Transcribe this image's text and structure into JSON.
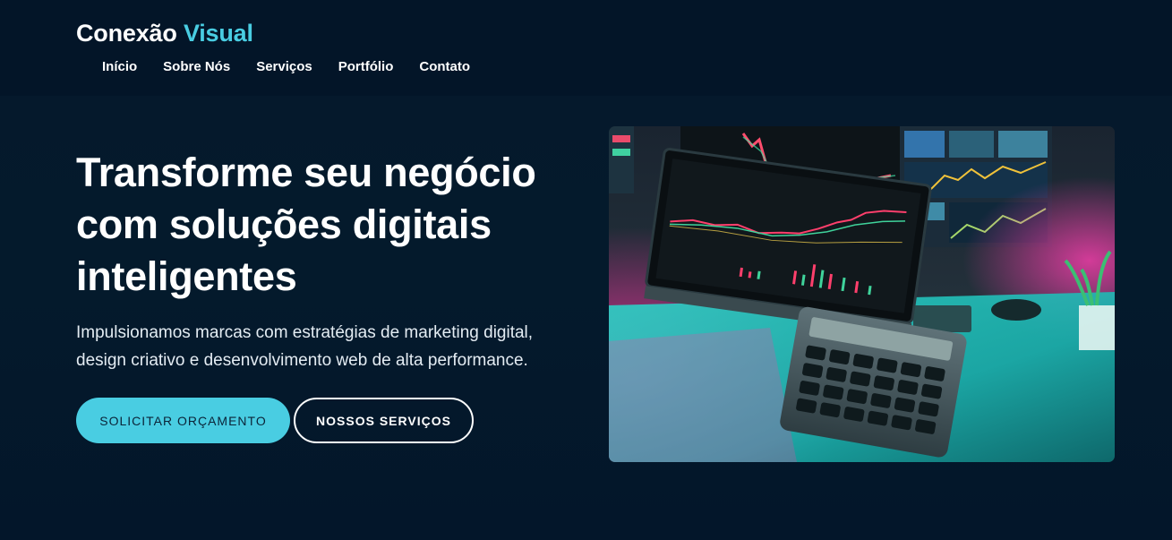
{
  "header": {
    "logo_main": "Conexão",
    "logo_accent": "Visual",
    "nav": [
      {
        "label": "Início"
      },
      {
        "label": "Sobre Nós"
      },
      {
        "label": "Serviços"
      },
      {
        "label": "Portfólio"
      },
      {
        "label": "Contato"
      }
    ]
  },
  "hero": {
    "title": "Transforme seu negócio com soluções digitais inteligentes",
    "subtitle": "Impulsionamos marcas com estratégias de marketing digital, design criativo e desenvolvimento web de alta performance.",
    "primary_button": "SOLICITAR ORÇAMENTO",
    "secondary_button": "NOSSOS SERVIÇOS",
    "image": "trading-desk-photo"
  },
  "colors": {
    "background": "#04152a",
    "accent": "#49cde2",
    "text": "#ffffff"
  }
}
